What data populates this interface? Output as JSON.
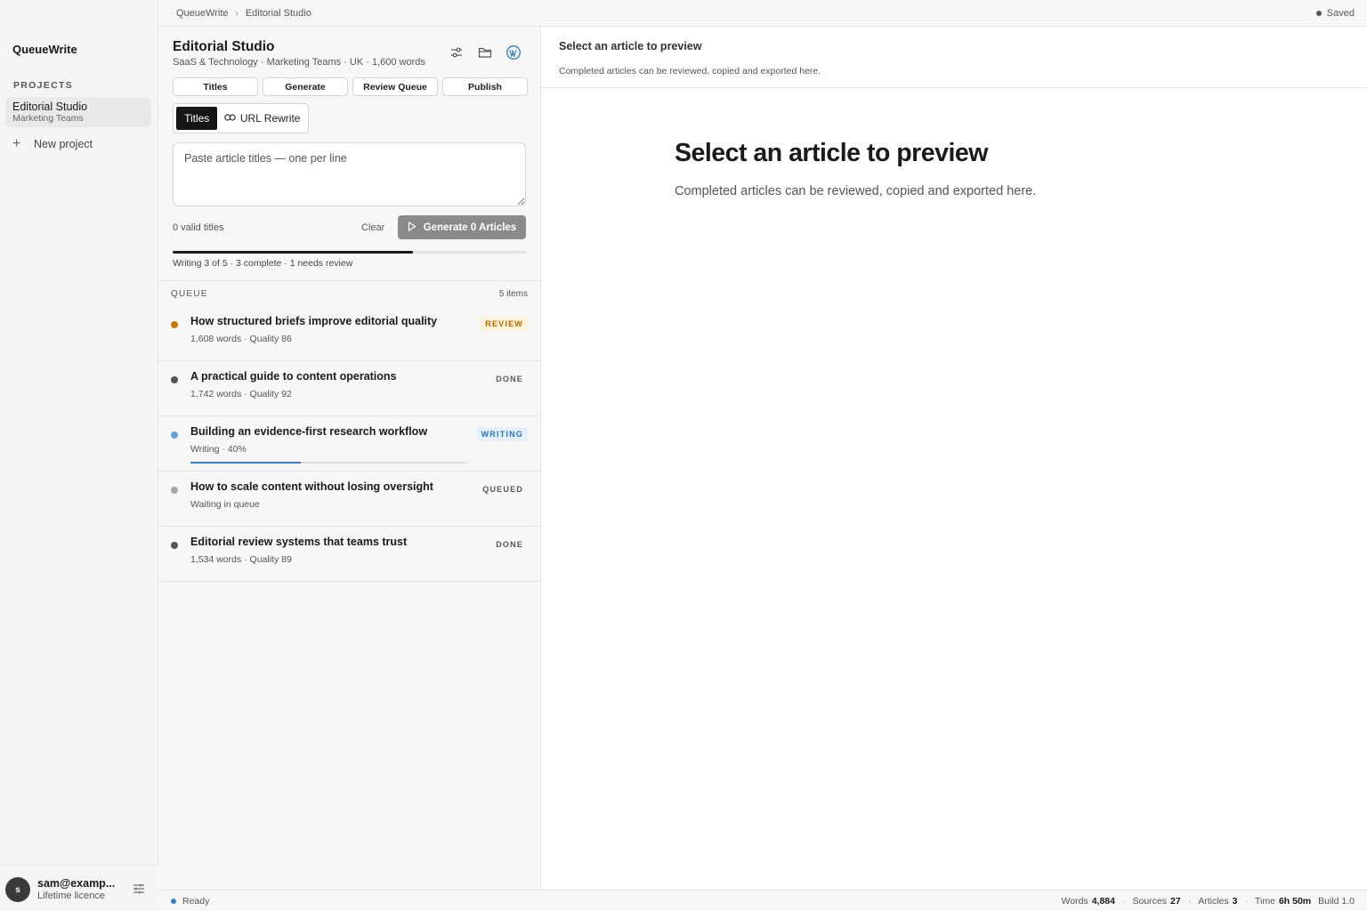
{
  "app": {
    "name": "QueueWrite"
  },
  "sidebar": {
    "projects_heading": "PROJECTS",
    "projects": [
      {
        "name": "Editorial Studio",
        "subtitle": "Marketing Teams"
      }
    ],
    "new_project_label": "New project",
    "user": {
      "initial": "s",
      "email": "sam@examp...",
      "licence": "Lifetime licence"
    }
  },
  "topbar": {
    "breadcrumb": [
      "QueueWrite",
      "Editorial Studio"
    ],
    "breadcrumb_separator": "›",
    "save_status": "Saved"
  },
  "project": {
    "title": "Editorial Studio",
    "meta": "SaaS & Technology · Marketing Teams · UK · 1,600 words",
    "header_icons": [
      "sliders-icon",
      "folder-icon",
      "wordpress-icon"
    ],
    "tabs": [
      "Titles",
      "Generate",
      "Review Queue",
      "Publish"
    ],
    "input_modes": {
      "active": "Titles",
      "inactive": "URL Rewrite"
    },
    "titles_placeholder": "Paste article titles — one per line",
    "valid_titles": "0 valid titles",
    "clear_label": "Clear",
    "generate_label": "Generate 0 Articles",
    "progress": {
      "fraction": 0.68,
      "status": "Writing 3 of 5 · 3 complete · 1 needs review"
    }
  },
  "queue": {
    "label": "QUEUE",
    "count": "5 items",
    "items": [
      {
        "title": "How structured briefs improve editorial quality",
        "meta": "1,608 words · Quality 86",
        "badge": "REVIEW",
        "dot_color": "#c9770c",
        "badge_color": "#b26a00",
        "badge_bg": "#fdf1d8"
      },
      {
        "title": "A practical guide to content operations",
        "meta": "1,742 words · Quality 92",
        "badge": "DONE",
        "dot_color": "#555555",
        "badge_color": "#555555",
        "badge_bg": "transparent"
      },
      {
        "title": "Building an evidence-first research workflow",
        "meta": "Writing · 40%",
        "badge": "WRITING",
        "dot_color": "#6aa0d8",
        "badge_color": "#2c73bb",
        "badge_bg": "#e4eff9",
        "progress": 0.4
      },
      {
        "title": "How to scale content without losing oversight",
        "meta": "Waiting in queue",
        "badge": "QUEUED",
        "dot_color": "#a5a5a5",
        "badge_color": "#555555",
        "badge_bg": "transparent"
      },
      {
        "title": "Editorial review systems that teams trust",
        "meta": "1,534 words · Quality 89",
        "badge": "DONE",
        "dot_color": "#555555",
        "badge_color": "#555555",
        "badge_bg": "transparent"
      }
    ]
  },
  "preview": {
    "header_title": "Select an article to preview",
    "header_subtitle": "Completed articles can be reviewed, copied and exported here.",
    "empty_title": "Select an article to preview",
    "empty_subtitle": "Completed articles can be reviewed, copied and exported here."
  },
  "statusbar": {
    "ready": "Ready",
    "stats": [
      {
        "label": "Words",
        "value": "4,884"
      },
      {
        "label": "Sources",
        "value": "27"
      },
      {
        "label": "Articles",
        "value": "3"
      },
      {
        "label": "Time",
        "value": "6h 50m"
      }
    ],
    "build": "Build 1.0"
  },
  "colors": {
    "accent": "#1a1a1a",
    "ready": "#3b7ec2",
    "generate_disabled": "#8a8a8a",
    "wordpress": "#2b7bb9"
  }
}
